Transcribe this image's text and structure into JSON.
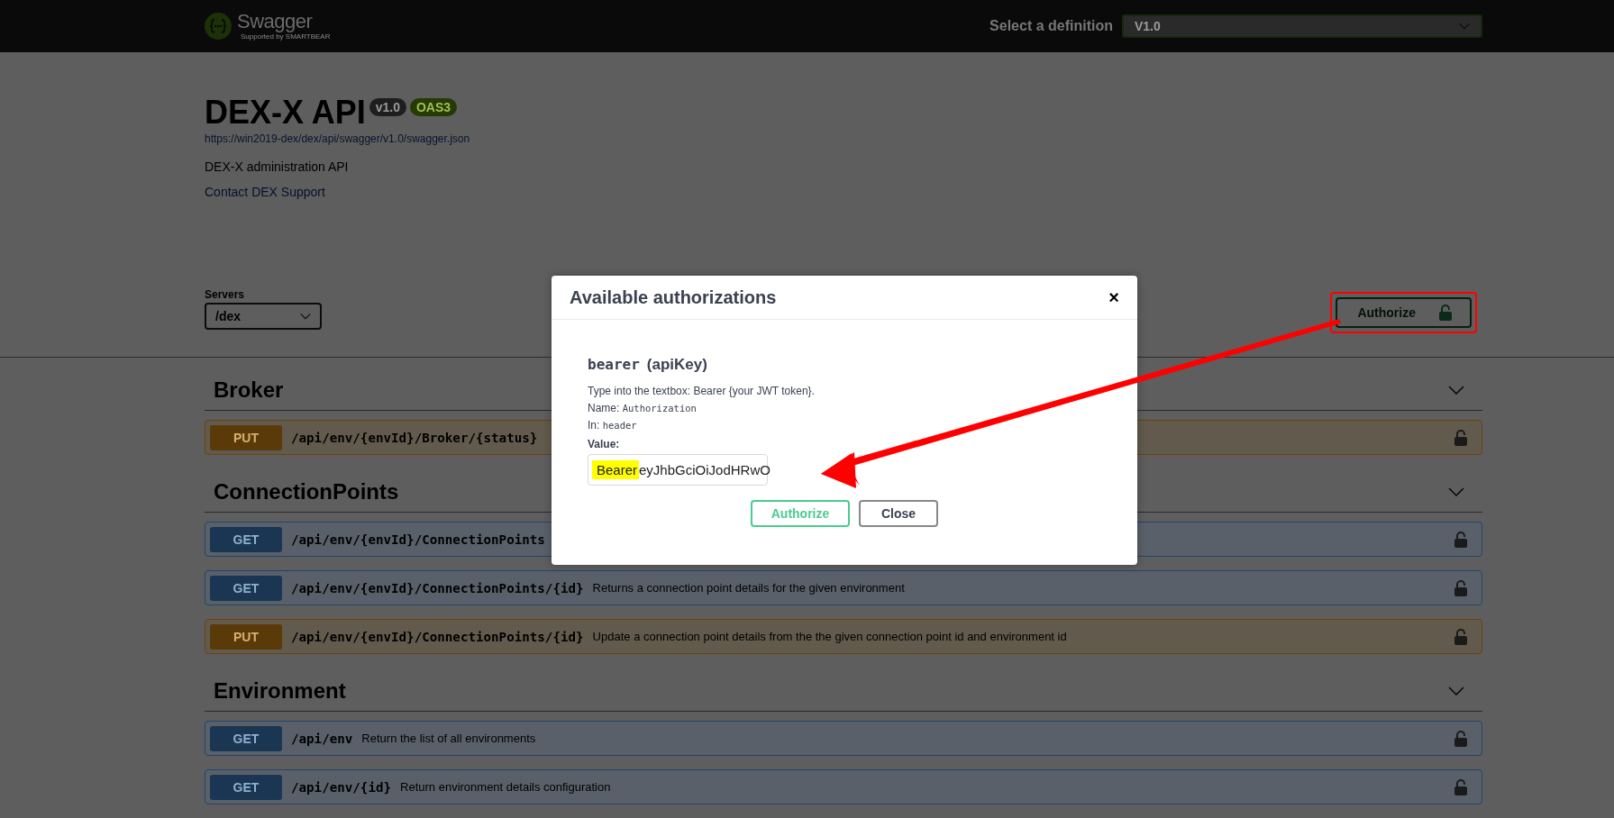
{
  "topbar": {
    "logo_text": "Swagger",
    "logo_subtext": "Supported by SMARTBEAR",
    "definition_label": "Select a definition",
    "definition_value": "V1.0"
  },
  "info": {
    "title": "DEX-X API",
    "badges": [
      {
        "text": "v1.0",
        "kind": "version"
      },
      {
        "text": "OAS3",
        "kind": "oas"
      }
    ],
    "url": "https://win2019-dex/dex/api/swagger/v1.0/swagger.json",
    "description": "DEX-X administration API",
    "contact": "Contact DEX Support"
  },
  "servers": {
    "label": "Servers",
    "value": "/dex"
  },
  "authorize_button": {
    "label": "Authorize",
    "highlighted": true
  },
  "sections": [
    {
      "name": "Broker",
      "expanded": true,
      "operations": [
        {
          "method": "PUT",
          "path": "/api/env/{envId}/Broker/{status}"
        }
      ]
    },
    {
      "name": "ConnectionPoints",
      "expanded": true,
      "operations": [
        {
          "method": "GET",
          "path": "/api/env/{envId}/ConnectionPoints"
        },
        {
          "method": "GET",
          "path": "/api/env/{envId}/ConnectionPoints/{id}",
          "summary": "Returns a connection point details for the given environment"
        },
        {
          "method": "PUT",
          "path": "/api/env/{envId}/ConnectionPoints/{id}",
          "summary": "Update a connection point details from the the given connection point id and environment id"
        }
      ]
    },
    {
      "name": "Environment",
      "expanded": true,
      "operations": [
        {
          "method": "GET",
          "path": "/api/env",
          "summary": "Return the list of all environments"
        },
        {
          "method": "GET",
          "path": "/api/env/{id}",
          "summary": "Return environment details configuration"
        }
      ]
    }
  ],
  "modal": {
    "title": "Available authorizations",
    "close": "×",
    "scheme_name": "bearer",
    "scheme_type": "(apiKey)",
    "hint": "Type into the textbox: Bearer {your JWT token}.",
    "params": [
      {
        "label": "Name:",
        "value": "Authorization"
      },
      {
        "label": "In:",
        "value": "header"
      }
    ],
    "value_label": "Value:",
    "value_parts": [
      {
        "text": "Bearer",
        "highlighted": true
      },
      {
        "text": "eyJhbGciOiJodHRwO",
        "highlighted": false
      }
    ],
    "buttons": [
      {
        "label": "Authorize",
        "kind": "primary"
      },
      {
        "label": "Close",
        "kind": "secondary"
      }
    ]
  }
}
